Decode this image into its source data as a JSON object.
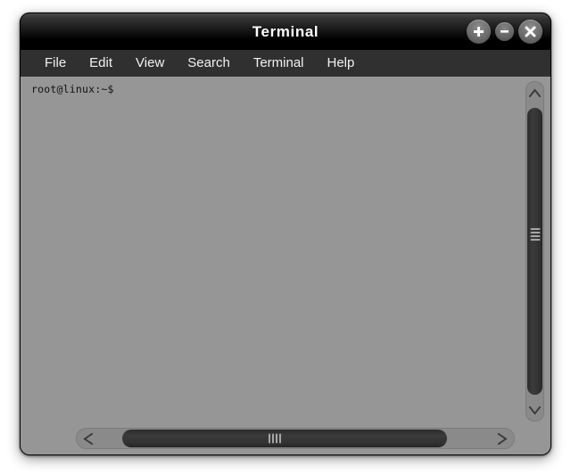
{
  "window": {
    "title": "Terminal",
    "controls": [
      {
        "name": "maximize-button",
        "icon": "plus-icon",
        "label": "+"
      },
      {
        "name": "minimize-button",
        "icon": "minus-icon",
        "label": "–"
      },
      {
        "name": "close-button",
        "icon": "close-icon",
        "label": "×"
      }
    ]
  },
  "menubar": {
    "items": [
      {
        "label": "File"
      },
      {
        "label": "Edit"
      },
      {
        "label": "View"
      },
      {
        "label": "Search"
      },
      {
        "label": "Terminal"
      },
      {
        "label": "Help"
      }
    ]
  },
  "terminal": {
    "prompt": "root@linux:~$",
    "background_color": "#969696",
    "text_color": "#111111"
  },
  "scrollbars": {
    "vertical": {
      "up_arrow_icon": "chevron-up-icon",
      "down_arrow_icon": "chevron-down-icon",
      "grip_lines": 4
    },
    "horizontal": {
      "left_arrow_icon": "chevron-left-icon",
      "right_arrow_icon": "chevron-right-icon",
      "grip_lines": 4
    }
  },
  "colors": {
    "titlebar": "#000000",
    "menubar": "#303030",
    "scrollbar_track": "#8a8a8a",
    "scrollbar_thumb": "#343434"
  }
}
